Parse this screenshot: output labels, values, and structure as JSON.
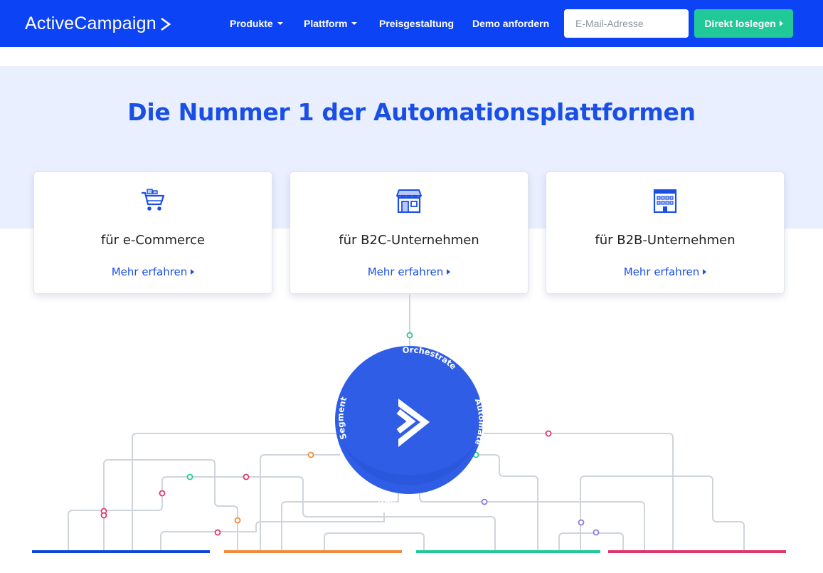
{
  "header": {
    "brand": "ActiveCampaign",
    "nav": [
      {
        "label": "Produkte",
        "dropdown": true
      },
      {
        "label": "Plattform",
        "dropdown": true
      },
      {
        "label": "Preisgestaltung",
        "dropdown": false
      },
      {
        "label": "Demo anfordern",
        "dropdown": false
      }
    ],
    "email_placeholder": "E-Mail-Adresse",
    "cta_label": "Direkt loslegen"
  },
  "hero": {
    "title": "Die Nummer 1 der Automationsplattformen"
  },
  "cards": [
    {
      "icon": "shopping-cart-icon",
      "title": "für e-Commerce",
      "link": "Mehr erfahren"
    },
    {
      "icon": "storefront-icon",
      "title": "für B2C-Unternehmen",
      "link": "Mehr erfahren"
    },
    {
      "icon": "office-building-icon",
      "title": "für B2B-Unternehmen",
      "link": "Mehr erfahren"
    }
  ],
  "hub": {
    "labels": [
      "Orchestrate",
      "Automate",
      "Personalize",
      "Segment"
    ]
  },
  "colors": {
    "brand_blue": "#0c44f5",
    "title_blue": "#1a4fe6",
    "cta_green": "#20c997",
    "line_blue": "#0d47d9",
    "line_orange": "#f08a3c",
    "line_green": "#20c997",
    "line_pink": "#e0356b"
  }
}
